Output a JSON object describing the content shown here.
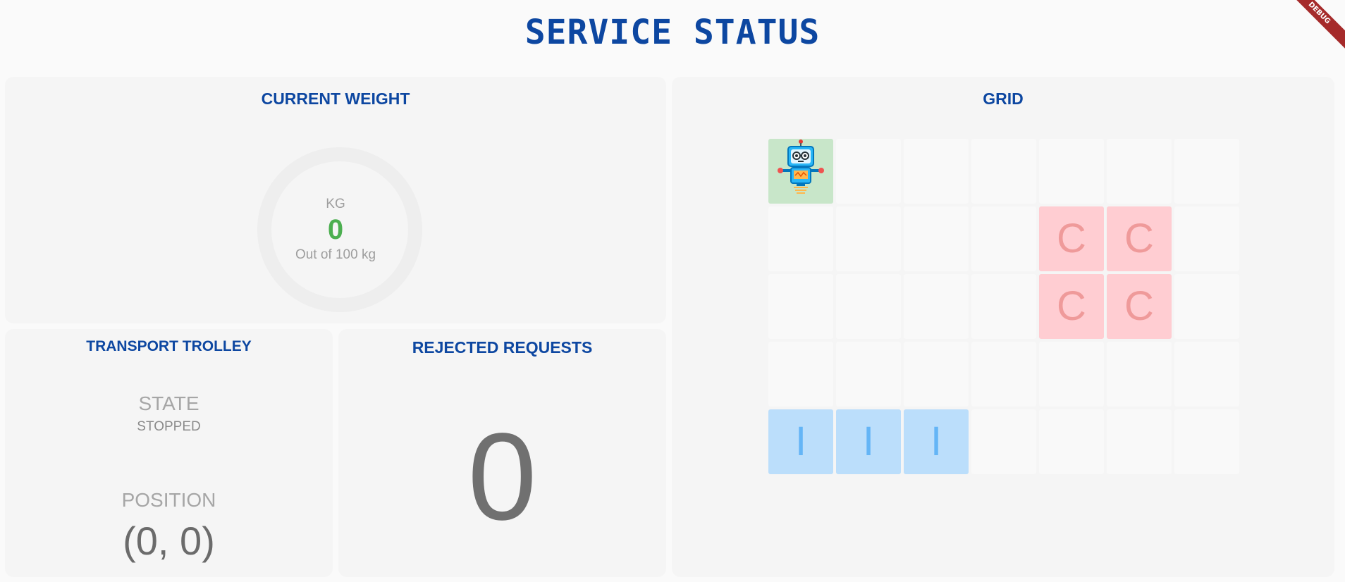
{
  "page": {
    "title": "SERVICE STATUS",
    "debug_banner": "DEBUG"
  },
  "current_weight": {
    "title": "CURRENT WEIGHT",
    "unit": "KG",
    "value": "0",
    "caption": "Out of 100 kg",
    "capacity_kg": 100,
    "fill_fraction": 0
  },
  "transport_trolley": {
    "title": "TRANSPORT TROLLEY",
    "state_label": "STATE",
    "state_value": "STOPPED",
    "position_label": "POSITION",
    "position_value": "(0, 0)"
  },
  "rejected_requests": {
    "title": "REJECTED REQUESTS",
    "value": "0"
  },
  "grid": {
    "title": "GRID",
    "rows": 5,
    "cols": 7,
    "cells": [
      [
        "robot",
        "",
        "",
        "",
        "",
        "",
        ""
      ],
      [
        "",
        "",
        "",
        "",
        "C",
        "C",
        ""
      ],
      [
        "",
        "",
        "",
        "",
        "C",
        "C",
        ""
      ],
      [
        "",
        "",
        "",
        "",
        "",
        "",
        ""
      ],
      [
        "I",
        "I",
        "I",
        "",
        "",
        "",
        ""
      ]
    ]
  },
  "colors": {
    "brand_blue": "#0d47a1",
    "weight_green": "#4caf50",
    "robot_cell": "#c8e6c9",
    "container_cell": "#ffcdd2",
    "container_text": "#ef9a9a",
    "item_cell": "#bbdefb",
    "item_text": "#64b5f6",
    "debug_ribbon": "#a52a2a"
  },
  "icons": {
    "robot": "robot-icon"
  }
}
